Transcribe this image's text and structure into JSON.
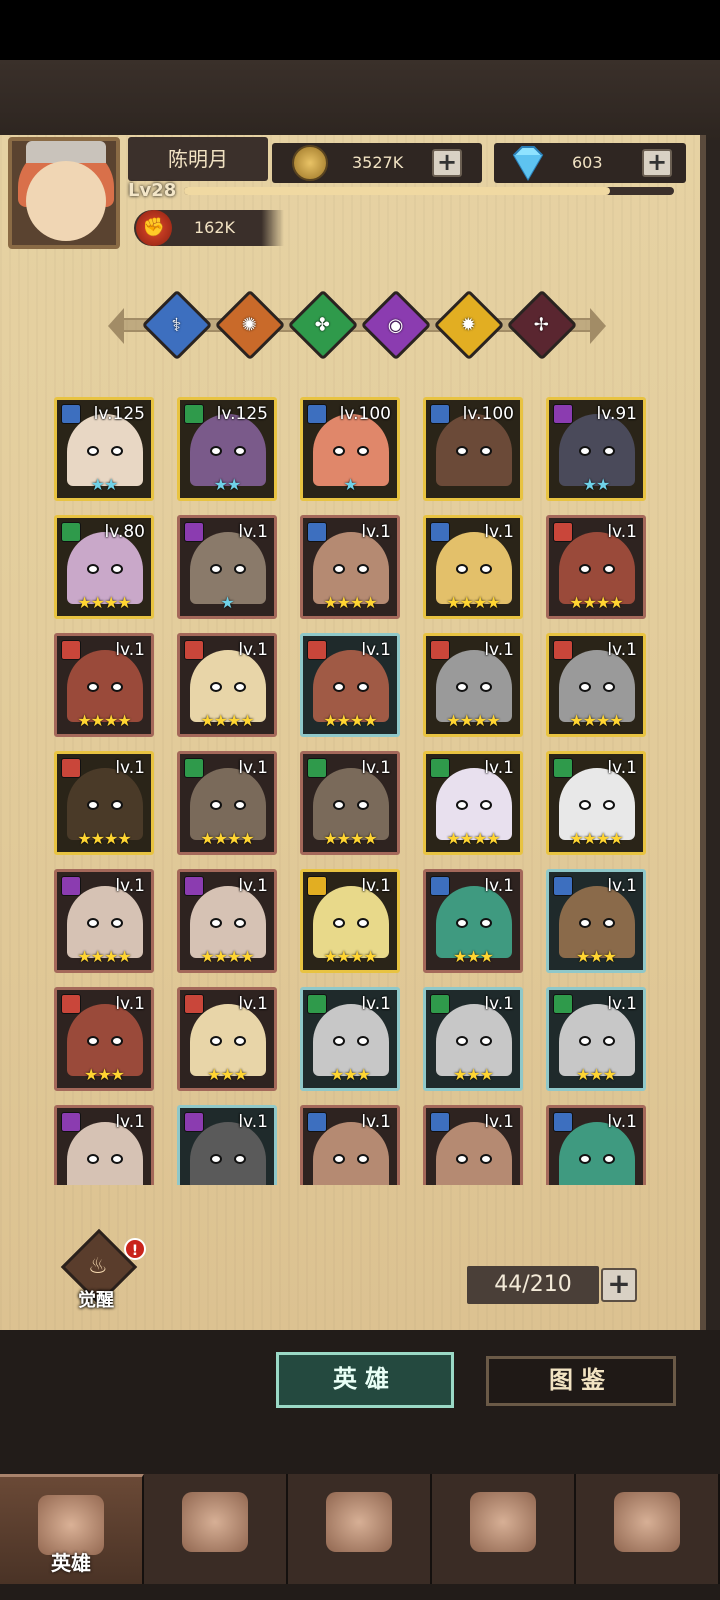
{
  "player": {
    "name": "陈明月",
    "level_label": "Lv28",
    "xp_fraction": 0.87,
    "power": "162K"
  },
  "currency": {
    "coins": {
      "value": "3527K",
      "icon": "coin-icon"
    },
    "gems": {
      "value": "603",
      "icon": "diamond-icon"
    },
    "plus": "+"
  },
  "filters": [
    {
      "name": "wind",
      "color": "#3d6fbf",
      "glyph": "⚕"
    },
    {
      "name": "fire",
      "color": "#c96a2a",
      "glyph": "✺"
    },
    {
      "name": "nature",
      "color": "#2f9a4b",
      "glyph": "✤"
    },
    {
      "name": "arcane",
      "color": "#8b3cb0",
      "glyph": "◉"
    },
    {
      "name": "light",
      "color": "#e2ae22",
      "glyph": "✹"
    },
    {
      "name": "shadow",
      "color": "#5a2630",
      "glyph": "✢"
    }
  ],
  "heroes": [
    {
      "lvl": "lv.125",
      "frame": "gold",
      "badge": "#3d6fbf",
      "stars": "★★",
      "star_color": "blue",
      "skin": "#e8d7c4"
    },
    {
      "lvl": "lv.125",
      "frame": "gold",
      "badge": "#2f9a4b",
      "stars": "★★",
      "star_color": "blue",
      "skin": "#7a5a8a"
    },
    {
      "lvl": "lv.100",
      "frame": "gold",
      "badge": "#3d6fbf",
      "stars": "★",
      "star_color": "blue",
      "skin": "#e0876a"
    },
    {
      "lvl": "lv.100",
      "frame": "gold",
      "badge": "#3d6fbf",
      "stars": "",
      "star_color": "blue",
      "skin": "#6b4a38"
    },
    {
      "lvl": "lv.91",
      "frame": "gold",
      "badge": "#8b3cb0",
      "stars": "★★",
      "star_color": "blue",
      "skin": "#4a4a5a"
    },
    {
      "lvl": "lv.80",
      "frame": "gold",
      "badge": "#2f9a4b",
      "stars": "★★★★",
      "star_color": "gold",
      "skin": "#c9a8c9"
    },
    {
      "lvl": "lv.1",
      "frame": "brown",
      "badge": "#8b3cb0",
      "stars": "★",
      "star_color": "blue",
      "skin": "#8a7a6a"
    },
    {
      "lvl": "lv.1",
      "frame": "brown",
      "badge": "#3d6fbf",
      "stars": "★★★★",
      "star_color": "gold",
      "skin": "#b58a72"
    },
    {
      "lvl": "lv.1",
      "frame": "gold",
      "badge": "#3d6fbf",
      "stars": "★★★★",
      "star_color": "gold",
      "skin": "#e3c06a"
    },
    {
      "lvl": "lv.1",
      "frame": "brown",
      "badge": "#c9463a",
      "stars": "★★★★",
      "star_color": "gold",
      "skin": "#9a4a3a"
    },
    {
      "lvl": "lv.1",
      "frame": "brown",
      "badge": "#c9463a",
      "stars": "★★★★",
      "star_color": "gold",
      "skin": "#9a4a3a"
    },
    {
      "lvl": "lv.1",
      "frame": "brown",
      "badge": "#c9463a",
      "stars": "★★★★",
      "star_color": "gold",
      "skin": "#e8d5a8"
    },
    {
      "lvl": "lv.1",
      "frame": "teal",
      "badge": "#c9463a",
      "stars": "★★★★",
      "star_color": "gold",
      "skin": "#a05a45"
    },
    {
      "lvl": "lv.1",
      "frame": "gold",
      "badge": "#c9463a",
      "stars": "★★★★",
      "star_color": "gold",
      "skin": "#9a9a9a"
    },
    {
      "lvl": "lv.1",
      "frame": "gold",
      "badge": "#c9463a",
      "stars": "★★★★",
      "star_color": "gold",
      "skin": "#9a9a9a"
    },
    {
      "lvl": "lv.1",
      "frame": "gold",
      "badge": "#c9463a",
      "stars": "★★★★",
      "star_color": "gold",
      "skin": "#4a3a28"
    },
    {
      "lvl": "lv.1",
      "frame": "brown",
      "badge": "#2f9a4b",
      "stars": "★★★★",
      "star_color": "gold",
      "skin": "#7a6a5a"
    },
    {
      "lvl": "lv.1",
      "frame": "brown",
      "badge": "#2f9a4b",
      "stars": "★★★★",
      "star_color": "gold",
      "skin": "#7a6a5a"
    },
    {
      "lvl": "lv.1",
      "frame": "gold",
      "badge": "#2f9a4b",
      "stars": "★★★★",
      "star_color": "gold",
      "skin": "#e8e0ee"
    },
    {
      "lvl": "lv.1",
      "frame": "gold",
      "badge": "#2f9a4b",
      "stars": "★★★★",
      "star_color": "gold",
      "skin": "#e8e8e8"
    },
    {
      "lvl": "lv.1",
      "frame": "brown",
      "badge": "#8b3cb0",
      "stars": "★★★★",
      "star_color": "gold",
      "skin": "#d6c2b4"
    },
    {
      "lvl": "lv.1",
      "frame": "brown",
      "badge": "#8b3cb0",
      "stars": "★★★★",
      "star_color": "gold",
      "skin": "#d6c2b4"
    },
    {
      "lvl": "lv.1",
      "frame": "gold",
      "badge": "#e2ae22",
      "stars": "★★★★",
      "star_color": "gold",
      "skin": "#e8d98a"
    },
    {
      "lvl": "lv.1",
      "frame": "brown",
      "badge": "#3d6fbf",
      "stars": "★★★",
      "star_color": "gold",
      "skin": "#3f9a80"
    },
    {
      "lvl": "lv.1",
      "frame": "teal",
      "badge": "#3d6fbf",
      "stars": "★★★",
      "star_color": "gold",
      "skin": "#8a6a4a"
    },
    {
      "lvl": "lv.1",
      "frame": "brown",
      "badge": "#c9463a",
      "stars": "★★★",
      "star_color": "gold",
      "skin": "#9a4a3a"
    },
    {
      "lvl": "lv.1",
      "frame": "brown",
      "badge": "#c9463a",
      "stars": "★★★",
      "star_color": "gold",
      "skin": "#e8d5a8"
    },
    {
      "lvl": "lv.1",
      "frame": "teal",
      "badge": "#2f9a4b",
      "stars": "★★★",
      "star_color": "gold",
      "skin": "#c7c7c7"
    },
    {
      "lvl": "lv.1",
      "frame": "teal",
      "badge": "#2f9a4b",
      "stars": "★★★",
      "star_color": "gold",
      "skin": "#c7c7c7"
    },
    {
      "lvl": "lv.1",
      "frame": "teal",
      "badge": "#2f9a4b",
      "stars": "★★★",
      "star_color": "gold",
      "skin": "#c7c7c7"
    },
    {
      "lvl": "lv.1",
      "frame": "brown",
      "badge": "#8b3cb0",
      "stars": "",
      "star_color": "gold",
      "skin": "#d6c2b4"
    },
    {
      "lvl": "lv.1",
      "frame": "teal",
      "badge": "#8b3cb0",
      "stars": "",
      "star_color": "gold",
      "skin": "#5a5a5a"
    },
    {
      "lvl": "lv.1",
      "frame": "brown",
      "badge": "#3d6fbf",
      "stars": "",
      "star_color": "gold",
      "skin": "#b58a72"
    },
    {
      "lvl": "lv.1",
      "frame": "brown",
      "badge": "#3d6fbf",
      "stars": "",
      "star_color": "gold",
      "skin": "#b58a72"
    },
    {
      "lvl": "lv.1",
      "frame": "brown",
      "badge": "#3d6fbf",
      "stars": "",
      "star_color": "gold",
      "skin": "#3f9a80"
    }
  ],
  "awaken": {
    "label": "觉醒",
    "alert": "!"
  },
  "capacity": {
    "value": "44/210",
    "plus": "+"
  },
  "tabs": {
    "heroes": "英雄",
    "codex": "图鉴"
  },
  "nav": [
    {
      "label": "英雄",
      "icon": "helmet-icon",
      "active": true
    },
    {
      "label": "",
      "icon": "flag-icon",
      "active": false
    },
    {
      "label": "",
      "icon": "crossed-swords-icon",
      "active": false
    },
    {
      "label": "",
      "icon": "castle-icon",
      "active": false
    },
    {
      "label": "",
      "icon": "handshake-emblem-icon",
      "active": false
    }
  ]
}
